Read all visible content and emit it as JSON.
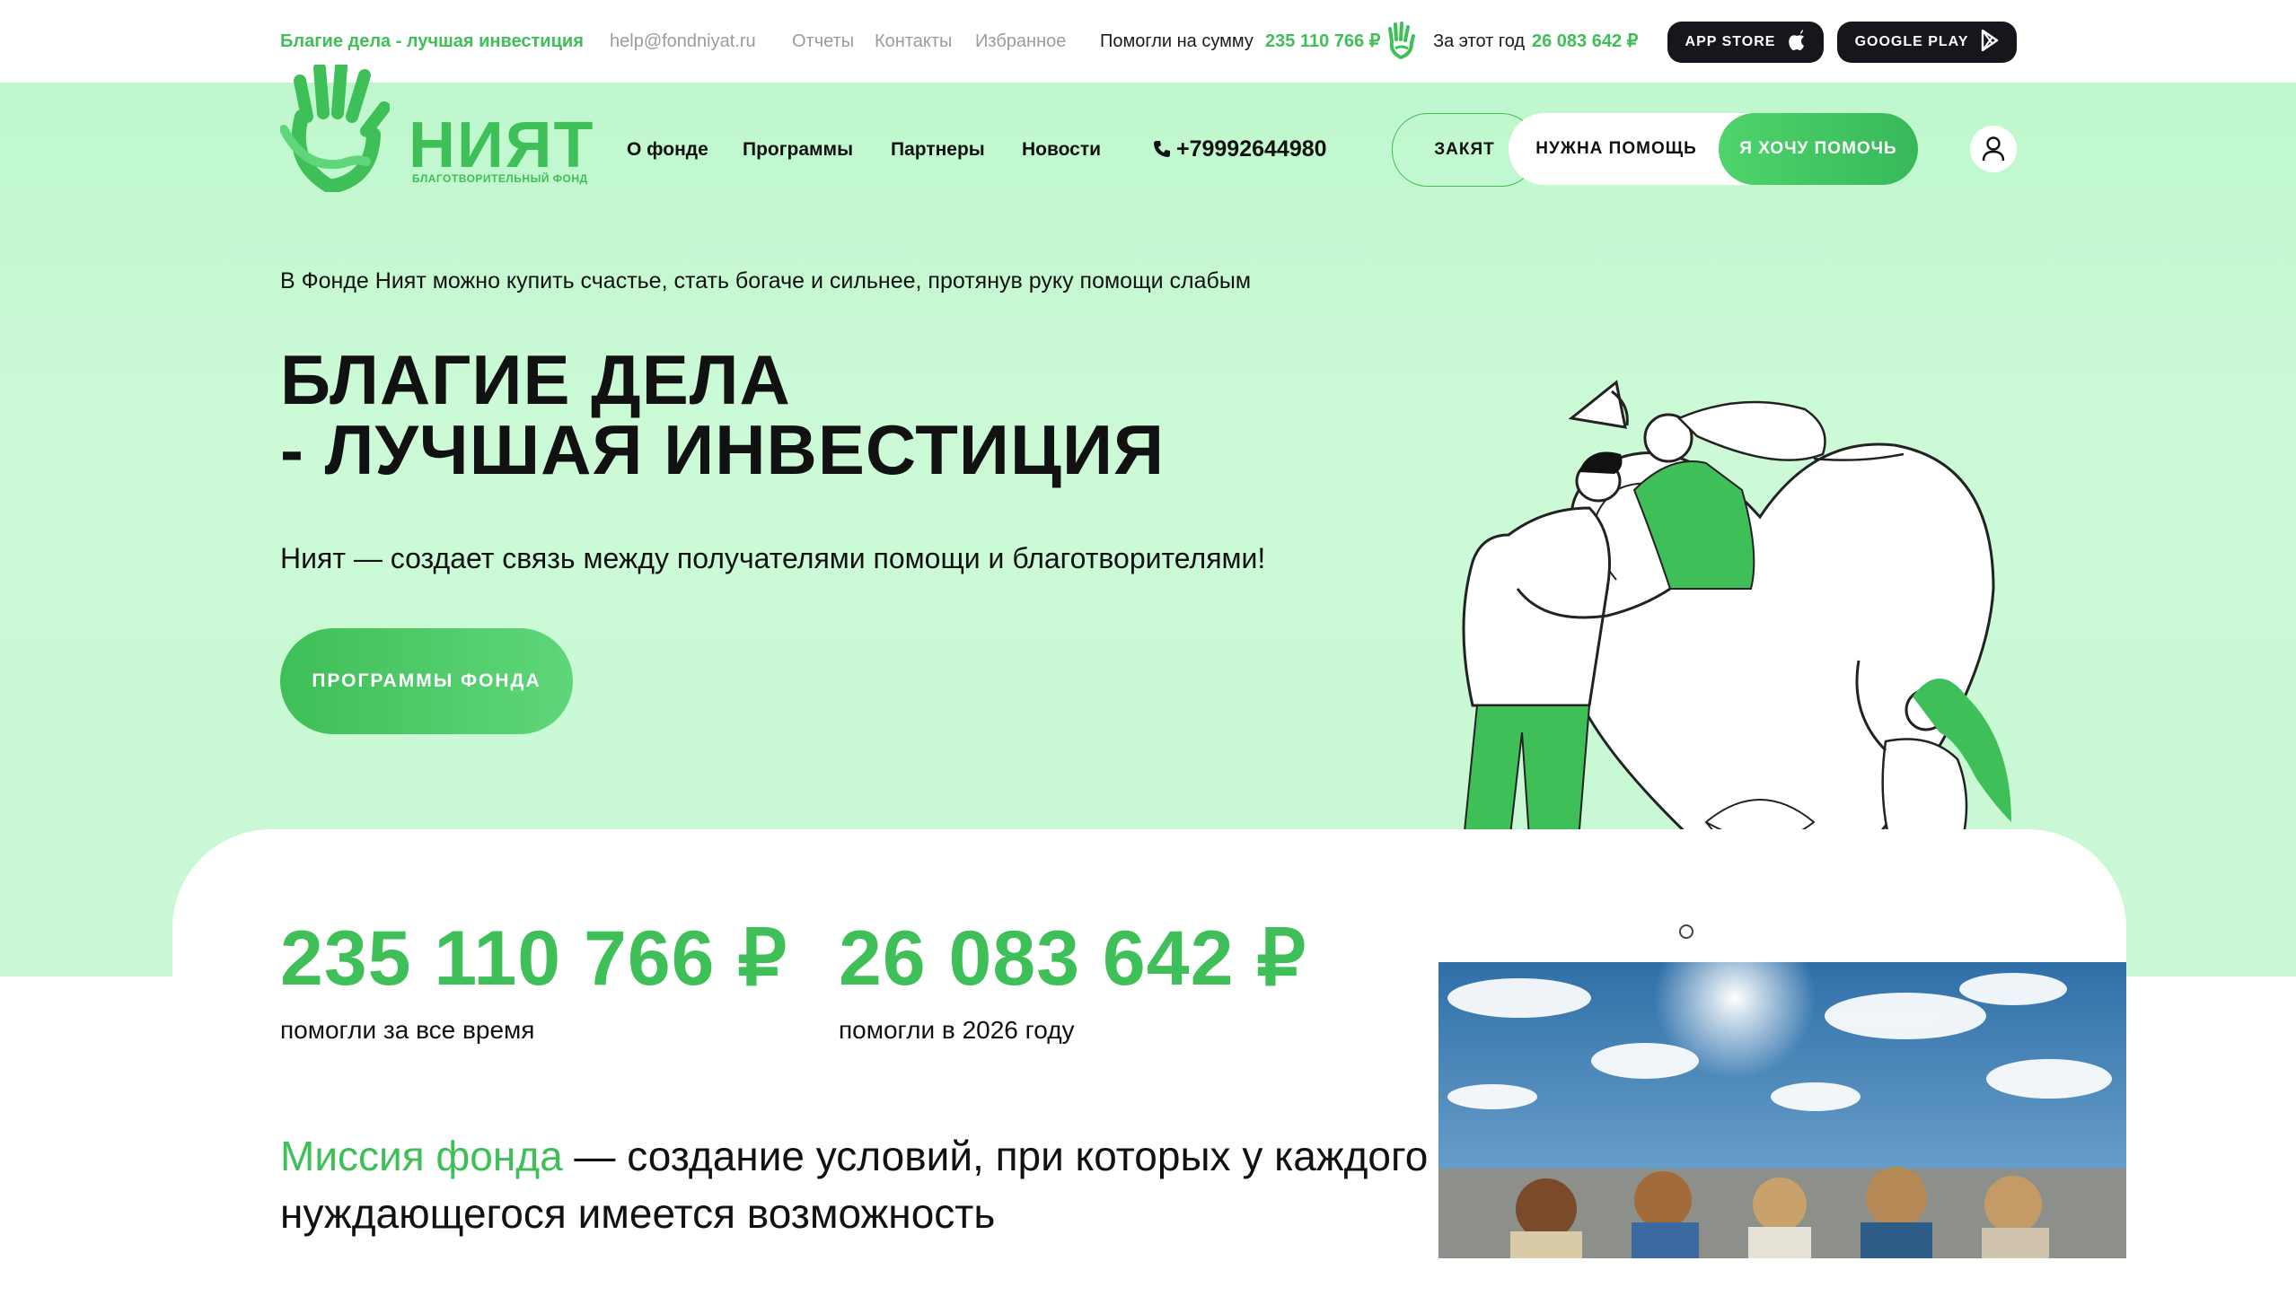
{
  "topbar": {
    "slogan": "Благие дела - лучшая инвестиция",
    "email": "help@fondniyat.ru",
    "links": [
      "Отчеты",
      "Контакты",
      "Избранное"
    ],
    "helped_label": "Помогли на сумму",
    "helped_value": "235 110 766 ₽",
    "year_label": "За этот год",
    "year_value": "26 083 642 ₽",
    "app_store": "APP STORE",
    "google_play": "GOOGLE PLAY"
  },
  "header": {
    "logo_word": "НИЯТ",
    "logo_sub": "БЛАГОТВОРИТЕЛЬНЫЙ ФОНД",
    "nav": [
      "О фонде",
      "Программы",
      "Партнеры",
      "Новости"
    ],
    "phone": "+79992644980",
    "zakat": "ЗАКЯТ",
    "need_help": "НУЖНА ПОМОЩЬ",
    "want_help": "Я ХОЧУ ПОМОЧЬ"
  },
  "hero": {
    "tagline": "В Фонде Ният можно купить счастье, стать богаче и сильнее, протянув руку помощи слабым",
    "title_line1": "БЛАГИЕ ДЕЛА",
    "title_line2": "- ЛУЧШАЯ ИНВЕСТИЦИЯ",
    "subtitle": "Ният — создает связь между получателями помощи и благотворителями!",
    "cta": "ПРОГРАММЫ ФОНДА"
  },
  "stats": [
    {
      "value": "235 110 766 ₽",
      "label": "помогли за все время"
    },
    {
      "value": "26 083 642 ₽",
      "label": "помогли в 2026 году"
    }
  ],
  "mission": {
    "highlight": "Миссия фонда",
    "text": " — создание условий, при которых у каждого нуждающегося имеется возможность"
  },
  "colors": {
    "accent": "#3fbf57",
    "hero_bg": "#c7f8d3",
    "dark_button": "#15171c"
  },
  "icons": [
    "hand-icon",
    "apple-icon",
    "google-play-icon",
    "phone-icon",
    "user-icon"
  ]
}
